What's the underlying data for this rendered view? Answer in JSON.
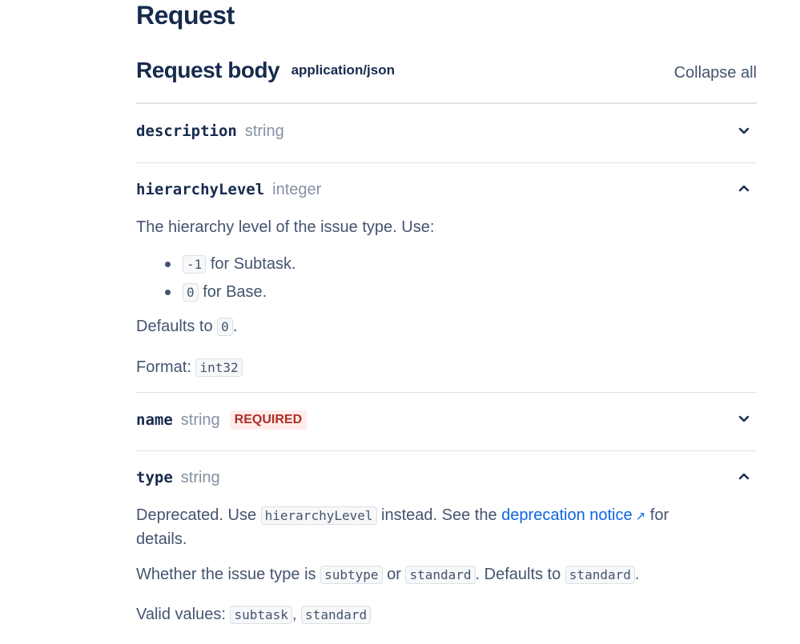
{
  "page_title": "Request",
  "request_body": {
    "title": "Request body",
    "content_type": "application/json",
    "collapse_all_label": "Collapse all"
  },
  "params": [
    {
      "name": "description",
      "type": "string",
      "expanded": false
    },
    {
      "name": "hierarchyLevel",
      "type": "integer",
      "expanded": true,
      "description": "The hierarchy level of the issue type. Use:",
      "bullets": [
        {
          "code": "-1",
          "text": " for Subtask."
        },
        {
          "code": "0",
          "text": " for Base."
        }
      ],
      "defaults_prefix": "Defaults to ",
      "defaults_code": "0",
      "defaults_suffix": ".",
      "format_prefix": "Format: ",
      "format_code": "int32"
    },
    {
      "name": "name",
      "type": "string",
      "required_label": "REQUIRED",
      "expanded": false
    },
    {
      "name": "type",
      "type": "string",
      "expanded": true,
      "deprecated_prefix": "Deprecated. Use ",
      "deprecated_code": "hierarchyLevel",
      "deprecated_mid": " instead. See the ",
      "deprecated_link": "deprecation notice",
      "deprecated_suffix": " for details.",
      "whether_prefix": "Whether the issue type is ",
      "whether_code1": "subtype",
      "whether_or": " or ",
      "whether_code2": "standard",
      "whether_defaults": ". Defaults to ",
      "whether_code3": "standard",
      "whether_end": ".",
      "valid_prefix": "Valid values: ",
      "valid_values": [
        "subtask",
        "standard"
      ],
      "valid_sep": ", "
    }
  ],
  "colors": {
    "text": "#172b4d",
    "muted": "#44546f",
    "type": "#8590a2",
    "link": "#0c66e4",
    "required_bg": "#ffeceb",
    "required_fg": "#ae2e24",
    "divider": "#dfe1e6"
  }
}
